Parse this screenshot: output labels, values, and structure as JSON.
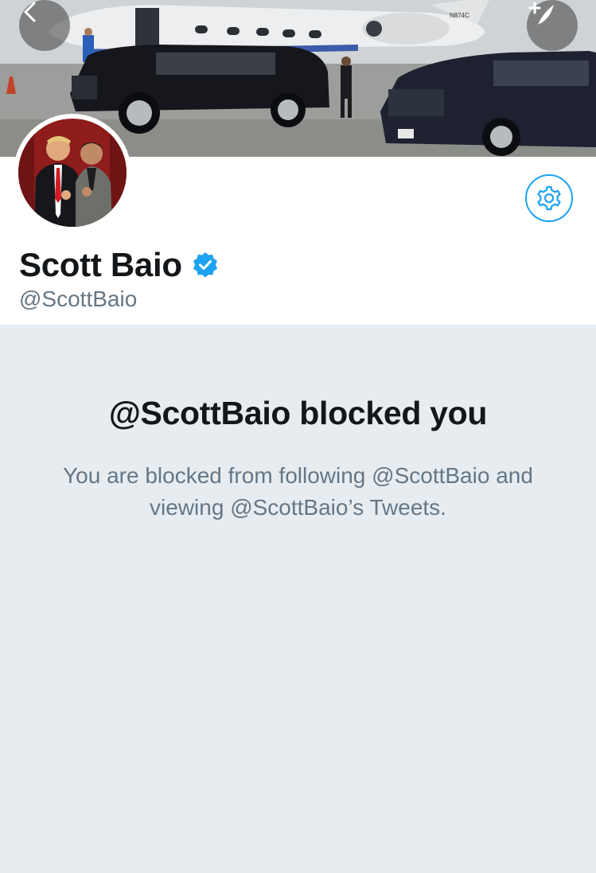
{
  "profile": {
    "display_name": "Scott Baio",
    "handle": "@ScottBaio",
    "verified": true
  },
  "icons": {
    "back": "chevron-left-icon",
    "compose": "compose-tweet-icon",
    "settings": "gear-icon",
    "verified": "verified-badge-icon"
  },
  "blocked": {
    "title": "@ScottBaio blocked you",
    "message": "You are blocked from following @ScottBaio and viewing @ScottBaio’s Tweets."
  },
  "colors": {
    "accent": "#1da1f2",
    "background": "#e6ecf0",
    "text_primary": "#14171a",
    "text_secondary": "#657786"
  }
}
